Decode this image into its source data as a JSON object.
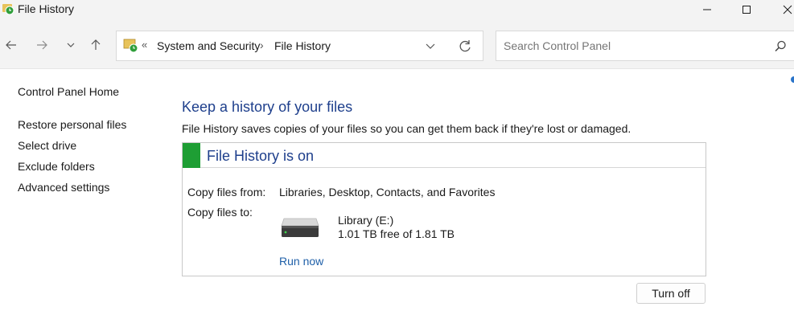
{
  "window": {
    "title": "File History",
    "app_icon": "file-history-icon",
    "controls": [
      "minimize-icon",
      "maximize-icon",
      "close-icon"
    ]
  },
  "navigation": {
    "buttons": [
      "back-arrow-icon",
      "forward-arrow-icon",
      "recent-locations-chevron-icon",
      "up-arrow-icon"
    ],
    "address": {
      "overflow_glyph": "«",
      "crumbs": [
        "System and Security",
        "File History"
      ],
      "separator": "›"
    },
    "search": {
      "placeholder": "Search Control Panel"
    }
  },
  "left_pane": {
    "home_link": "Control Panel Home",
    "links": [
      "Restore personal files",
      "Select drive",
      "Exclude folders",
      "Advanced settings"
    ]
  },
  "main": {
    "heading": "Keep a history of your files",
    "description": "File History saves copies of your files so you can get them back if they're lost or damaged.",
    "status": {
      "title": "File History is on",
      "indicator_color": "#1e9e34",
      "copy_from_label": "Copy files from:",
      "copy_from_value": "Libraries, Desktop, Contacts, and Favorites",
      "copy_to_label": "Copy files to:",
      "drive": {
        "icon": "hard-drive-icon",
        "name": "Library (E:)",
        "space": "1.01 TB free of 1.81 TB"
      },
      "run_now": "Run now"
    },
    "turn_off_button": "Turn off"
  },
  "colors": {
    "heading_blue": "#1e3f8c",
    "link_blue": "#1e5fa8",
    "chrome_bg": "#f3f3f3"
  }
}
